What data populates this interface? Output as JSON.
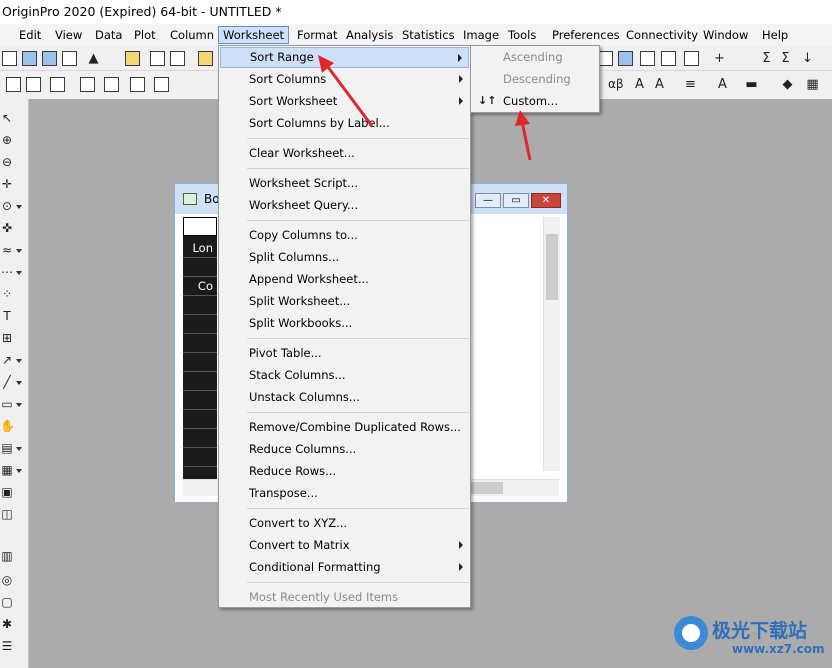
{
  "window": {
    "title": "OriginPro 2020 (Expired) 64-bit - UNTITLED *"
  },
  "menubar": [
    {
      "label": "Edit"
    },
    {
      "label": "View"
    },
    {
      "label": "Data"
    },
    {
      "label": "Plot"
    },
    {
      "label": "Column"
    },
    {
      "label": "Worksheet"
    },
    {
      "label": "Format"
    },
    {
      "label": "Analysis"
    },
    {
      "label": "Statistics"
    },
    {
      "label": "Image"
    },
    {
      "label": "Tools"
    },
    {
      "label": "Preferences"
    },
    {
      "label": "Connectivity"
    },
    {
      "label": "Window"
    },
    {
      "label": "Help"
    }
  ],
  "active_menu": "Worksheet",
  "worksheet_window": {
    "title": "Bo",
    "cells": [
      "",
      "Lon",
      "",
      "Co"
    ]
  },
  "worksheet_menu": [
    {
      "label": "Sort Range",
      "submenu": true,
      "highlighted": true
    },
    {
      "label": "Sort Columns",
      "submenu": true
    },
    {
      "label": "Sort Worksheet",
      "submenu": true
    },
    {
      "label": "Sort Columns by Label..."
    },
    {
      "label": "Clear Worksheet..."
    },
    {
      "label": "Worksheet Script..."
    },
    {
      "label": "Worksheet Query..."
    },
    {
      "label": "Copy Columns to..."
    },
    {
      "label": "Split Columns..."
    },
    {
      "label": "Append Worksheet..."
    },
    {
      "label": "Split Worksheet..."
    },
    {
      "label": "Split Workbooks..."
    },
    {
      "label": "Pivot Table..."
    },
    {
      "label": "Stack Columns..."
    },
    {
      "label": "Unstack Columns..."
    },
    {
      "label": "Remove/Combine Duplicated Rows..."
    },
    {
      "label": "Reduce Columns..."
    },
    {
      "label": "Reduce Rows..."
    },
    {
      "label": "Transpose..."
    },
    {
      "label": "Convert to XYZ..."
    },
    {
      "label": "Convert to Matrix",
      "submenu": true
    },
    {
      "label": "Conditional Formatting",
      "submenu": true
    },
    {
      "label": "Most Recently Used Items",
      "disabled": true
    }
  ],
  "sort_range_submenu": [
    {
      "label": "Ascending",
      "disabled": true
    },
    {
      "label": "Descending",
      "disabled": true
    },
    {
      "label": "Custom..."
    }
  ],
  "watermark": {
    "name": "极光下载站",
    "url": "www.xz7.com"
  },
  "colors": {
    "highlight": "#cde0f7",
    "arrow": "#e0262b",
    "menu_bg": "#f2f2f2"
  }
}
